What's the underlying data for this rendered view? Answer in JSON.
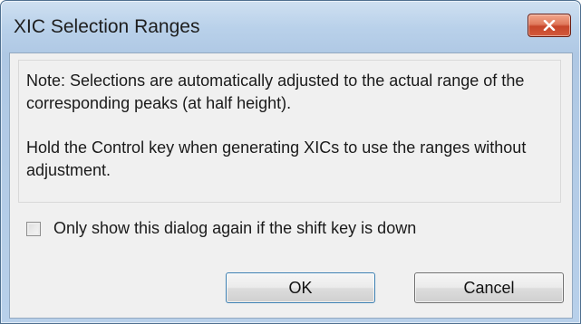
{
  "window": {
    "title": "XIC Selection Ranges",
    "close_icon": "close-x-icon"
  },
  "note": {
    "paragraph1": "Note: Selections are automatically adjusted to the actual range of the corresponding peaks (at half height).",
    "paragraph2": "Hold the Control key when generating XICs to use the ranges without adjustment."
  },
  "checkbox": {
    "label": "Only show this dialog again if the shift key is down",
    "checked": false
  },
  "buttons": {
    "ok_label": "OK",
    "cancel_label": "Cancel"
  },
  "colors": {
    "frame": "#b9d1ea",
    "close_button": "#c6452a",
    "client_background": "#f0f0f0"
  }
}
